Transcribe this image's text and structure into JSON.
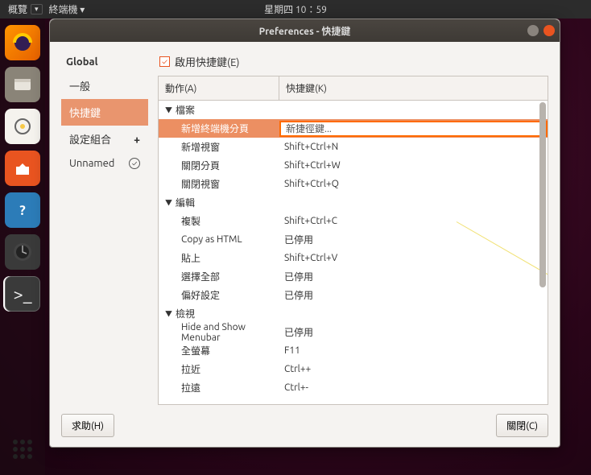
{
  "topbar": {
    "overview": "概覽",
    "appmenu": "終端機 ▾",
    "clock": "星期四 10：59"
  },
  "launcher": {
    "terminal_label": ">_"
  },
  "window": {
    "title": "Preferences - 快捷鍵",
    "sidebar": {
      "global": "Global",
      "items": [
        {
          "label": "一般"
        },
        {
          "label": "快捷鍵"
        },
        {
          "label": "設定組合",
          "plus": "+"
        }
      ],
      "profile": "Unnamed"
    },
    "enable_label": "啟用快捷鍵(E)",
    "columns": {
      "action": "動作(A)",
      "shortcut": "快捷鍵(K)"
    },
    "sections": [
      {
        "name": "檔案",
        "rows": [
          {
            "action": "新增終端機分頁",
            "shortcut": "新捷徑鍵...",
            "selected": true
          },
          {
            "action": "新增視窗",
            "shortcut": "Shift+Ctrl+N"
          },
          {
            "action": "關閉分頁",
            "shortcut": "Shift+Ctrl+W"
          },
          {
            "action": "關閉視窗",
            "shortcut": "Shift+Ctrl+Q"
          }
        ]
      },
      {
        "name": "編輯",
        "rows": [
          {
            "action": "複製",
            "shortcut": "Shift+Ctrl+C"
          },
          {
            "action": "Copy as HTML",
            "shortcut": "已停用"
          },
          {
            "action": "貼上",
            "shortcut": "Shift+Ctrl+V"
          },
          {
            "action": "選擇全部",
            "shortcut": "已停用"
          },
          {
            "action": "偏好設定",
            "shortcut": "已停用"
          }
        ]
      },
      {
        "name": "檢視",
        "rows": [
          {
            "action": "Hide and Show Menubar",
            "shortcut": "已停用"
          },
          {
            "action": "全螢幕",
            "shortcut": "F11"
          },
          {
            "action": "拉近",
            "shortcut": "Ctrl++"
          },
          {
            "action": "拉遠",
            "shortcut": "Ctrl+-"
          }
        ]
      }
    ],
    "footer": {
      "help": "求助(H)",
      "close": "關閉(C)"
    }
  }
}
